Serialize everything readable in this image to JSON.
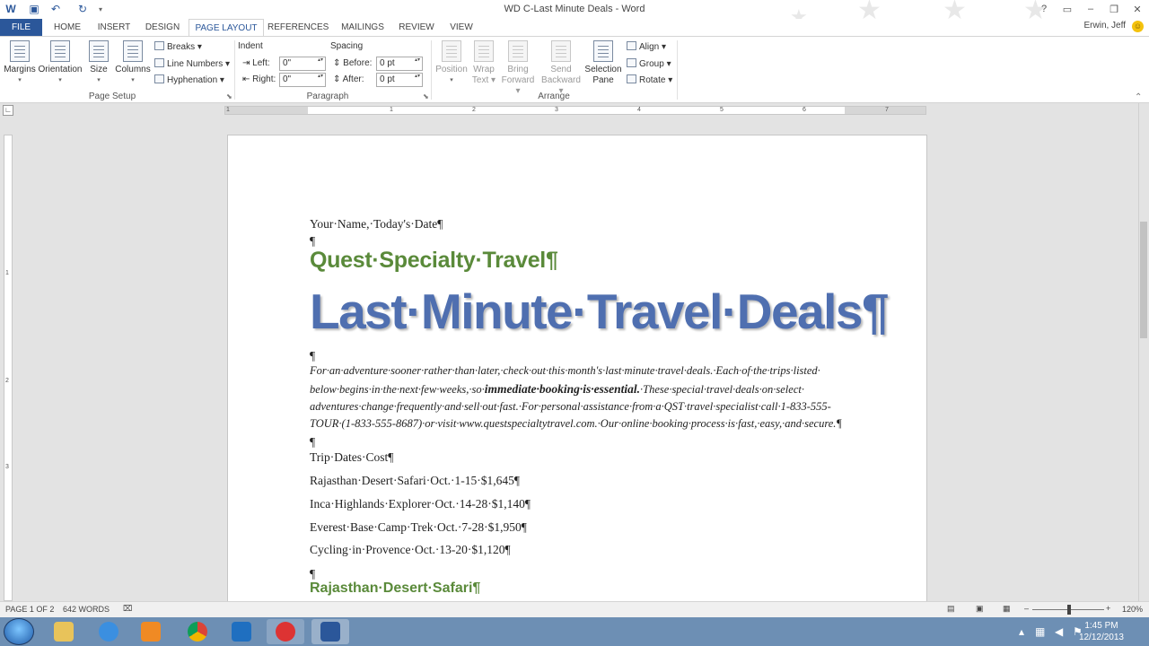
{
  "window": {
    "title": "WD C-Last Minute Deals - Word",
    "user": "Erwin, Jeff",
    "controls": [
      "?",
      "▭",
      "–",
      "❐",
      "✕"
    ]
  },
  "tabs": [
    "FILE",
    "HOME",
    "INSERT",
    "DESIGN",
    "PAGE LAYOUT",
    "REFERENCES",
    "MAILINGS",
    "REVIEW",
    "VIEW"
  ],
  "ribbon": {
    "page_setup": {
      "margins": "Margins",
      "orientation": "Orientation",
      "size": "Size",
      "columns": "Columns",
      "breaks": "Breaks",
      "line_numbers": "Line Numbers",
      "hyphenation": "Hyphenation",
      "group_label": "Page Setup"
    },
    "paragraph": {
      "indent_label": "Indent",
      "spacing_label": "Spacing",
      "left_label": "Left:",
      "right_label": "Right:",
      "before_label": "Before:",
      "after_label": "After:",
      "left_value": "0\"",
      "right_value": "0\"",
      "before_value": "0 pt",
      "after_value": "0 pt",
      "group_label": "Paragraph"
    },
    "arrange": {
      "position": "Position",
      "wrap_text_1": "Wrap",
      "wrap_text_2": "Text",
      "bring_forward_1": "Bring",
      "bring_forward_2": "Forward",
      "send_backward_1": "Send",
      "send_backward_2": "Backward",
      "selection_pane_1": "Selection",
      "selection_pane_2": "Pane",
      "align": "Align",
      "group": "Group",
      "rotate": "Rotate",
      "group_label": "Arrange"
    }
  },
  "ruler": {
    "numbers": [
      "1",
      "1",
      "2",
      "3",
      "4",
      "5",
      "6",
      "7"
    ],
    "vnumbers": [
      "1",
      "2",
      "3"
    ]
  },
  "document": {
    "byline": "Your·Name,·Today's·Date¶",
    "pilcrow": "¶",
    "heading1": "Quest·Specialty·Travel¶",
    "heading2": "Last·Minute·Travel·Deals¶",
    "intro_lines": [
      "For·an·adventure·sooner·rather·than·later,·check·out·this·month's·last·minute·travel·deals.·Each·of·the·trips·listed·",
      "below·begins·in·the·next·few·weeks,·so·",
      "immediate·booking·is·essential.",
      "·These·special·travel·deals·on·select·",
      "adventures·change·frequently·and·sell·out·fast.·For·personal·assistance·from·a·QST·travel·specialist·call·1-833-555-",
      "TOUR·(1-833-555-8687)·or·visit·www.questspecialtytravel.com.·Our·online·booking·process·is·fast,·easy,·and·secure.¶"
    ],
    "table_rows": [
      "Trip·Dates·Cost¶",
      "Rajasthan·Desert·Safari·Oct.·1-15·$1,645¶",
      "Inca·Highlands·Explorer·Oct.·14-28·$1,140¶",
      "Everest·Base·Camp·Trek·Oct.·7-28·$1,950¶",
      "Cycling·in·Provence·Oct.·13-20·$1,120¶"
    ],
    "heading3": "Rajasthan·Desert·Safari¶"
  },
  "status": {
    "page": "PAGE 1 OF 2",
    "words": "642 WORDS",
    "zoom": "120%"
  },
  "taskbar": {
    "time": "1:45 PM",
    "date": "12/12/2013"
  }
}
